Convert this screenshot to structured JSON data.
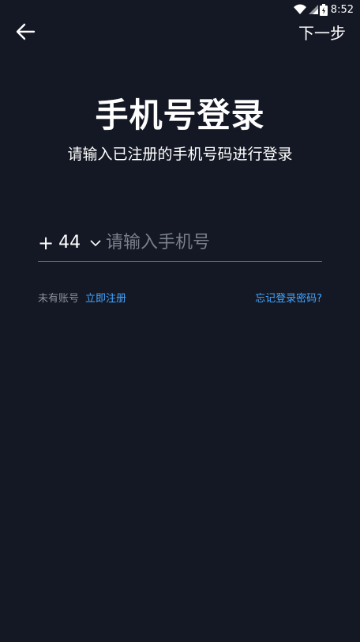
{
  "status_bar": {
    "time": "8:52",
    "icons": [
      "wifi-icon",
      "signal-icon",
      "battery-icon"
    ]
  },
  "topbar": {
    "back_icon": "arrow-left-icon",
    "next_label": "下一步"
  },
  "header": {
    "title": "手机号登录",
    "subtitle": "请输入已注册的手机号码进行登录"
  },
  "phone_form": {
    "country_code_prefix": "+",
    "country_code": "44",
    "chevron_icon": "chevron-down-icon",
    "phone_placeholder": "请输入手机号",
    "phone_value": ""
  },
  "links": {
    "no_account_text": "未有账号",
    "register_label": "立即注册",
    "forgot_password_label": "忘记登录密码?"
  },
  "colors": {
    "background": "#141824",
    "text_primary": "#ffffff",
    "text_muted": "#8a8f9a",
    "link": "#44a6ff",
    "divider": "#6b6f7a"
  }
}
